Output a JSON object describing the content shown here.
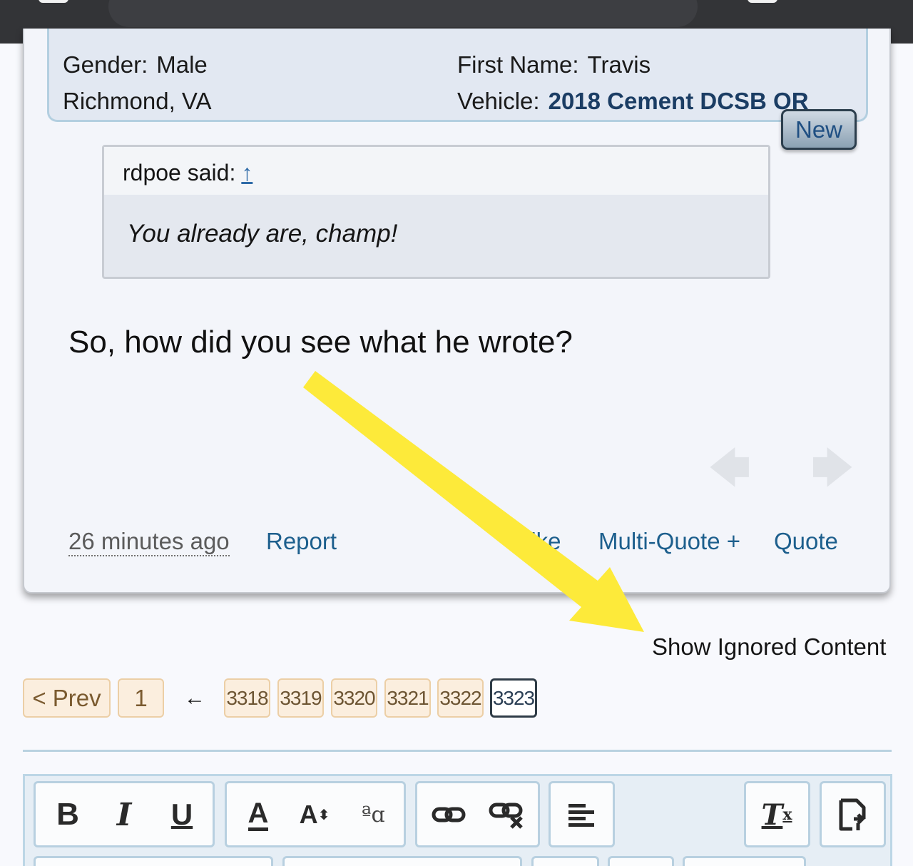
{
  "profile": {
    "gender_label": "Gender:",
    "gender_value": "Male",
    "location": "Richmond, VA",
    "first_name_label": "First Name:",
    "first_name_value": "Travis",
    "vehicle_label": "Vehicle:",
    "vehicle_value": "2018 Cement DCSB OR"
  },
  "new_badge": "New",
  "quote": {
    "author_text": "rdpoe said:",
    "jump_link": "↑",
    "body": "You already are, champ!"
  },
  "post": {
    "message": "So, how did you see what he wrote?",
    "prev_arrow": "🡄",
    "next_arrow": "🡆",
    "time": "26 minutes ago",
    "report": "Report",
    "like": "Like",
    "multiquote": "Multi-Quote +",
    "quote": "Quote"
  },
  "show_ignored": "Show Ignored Content",
  "pagination": {
    "prev": "< Prev",
    "first": "1",
    "ellipsis": "←",
    "pages": [
      "3318",
      "3319",
      "3320",
      "3321",
      "3322",
      "3323"
    ],
    "current": "3323"
  },
  "toolbar": {
    "bold": "B",
    "italic": "I",
    "underline": "U",
    "text_color": "A",
    "font_size": "A",
    "font_size_arrows": "⬍",
    "font_family": "ªɑ",
    "link": "🔗",
    "unlink": "⛓",
    "align": "≡",
    "remove_format": "T",
    "remove_format_x": "x",
    "toggle_bbcode": "⚙"
  },
  "colors": {
    "accent_link": "#1d5f8d",
    "annotation": "#fdea3a",
    "pagination_bg": "#fbeede"
  }
}
